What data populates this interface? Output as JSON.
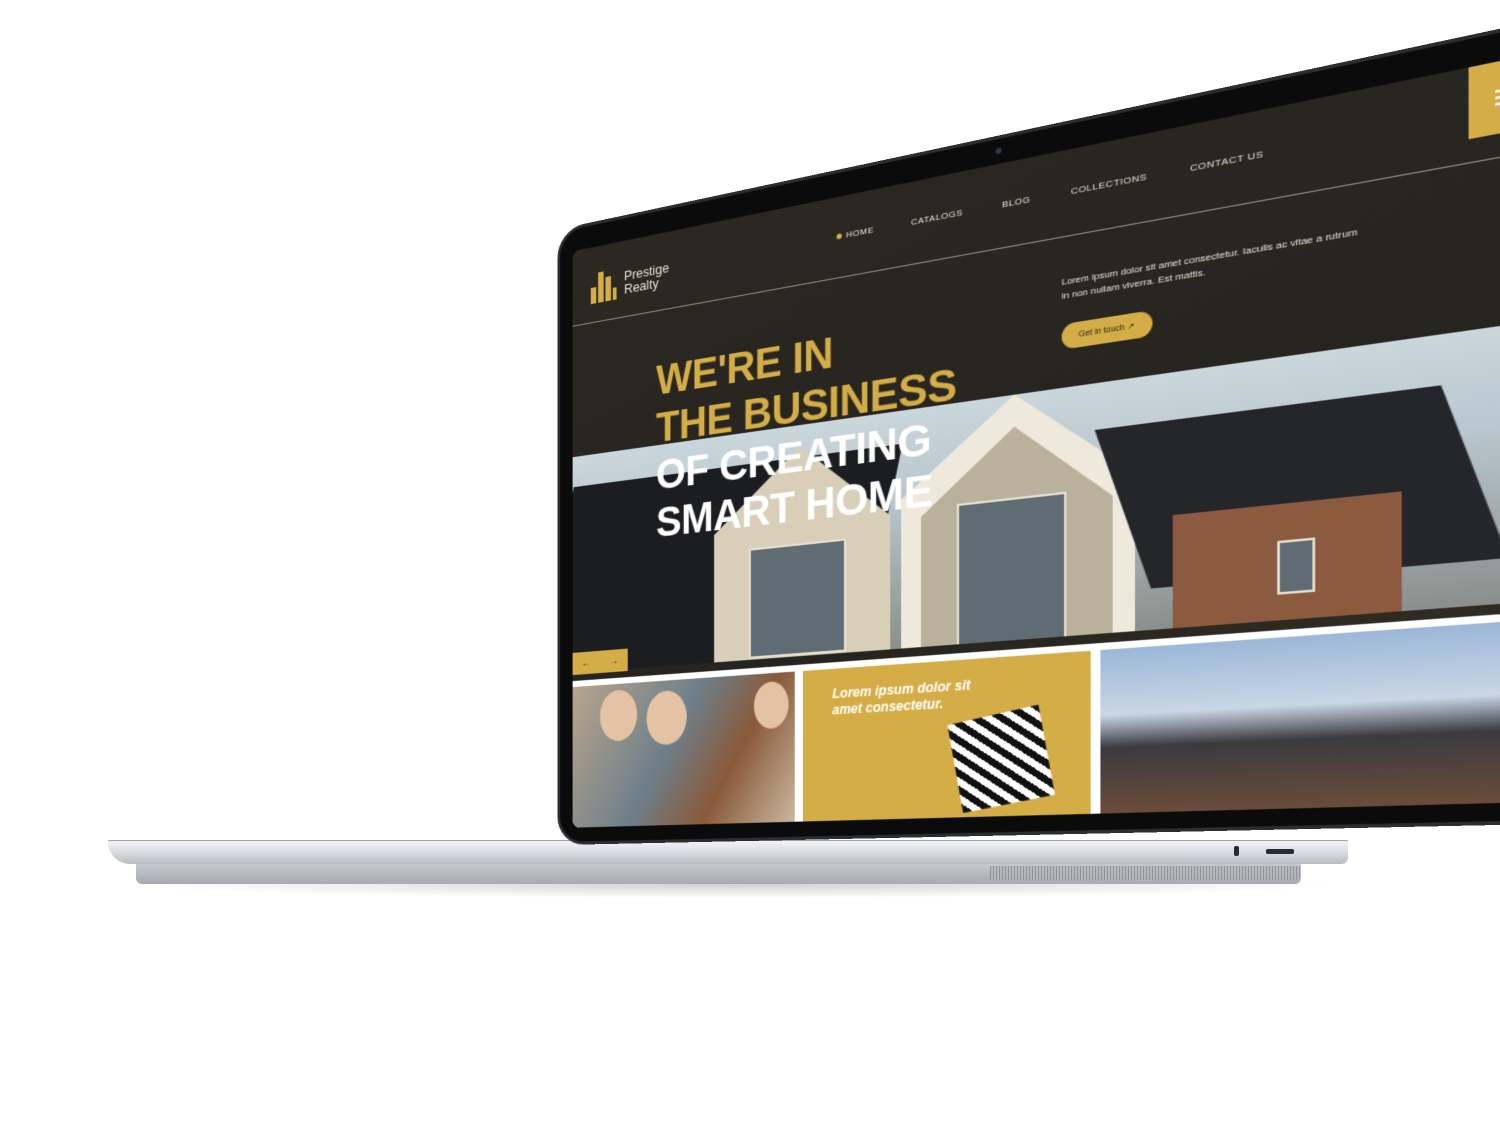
{
  "site": {
    "brand": {
      "line1": "Prestige",
      "line2": "Realty"
    },
    "nav": [
      {
        "label": "HOME",
        "active": true
      },
      {
        "label": "CATALOGS",
        "active": false
      },
      {
        "label": "BLOG",
        "active": false
      },
      {
        "label": "COLLECTIONS",
        "active": false
      },
      {
        "label": "CONTACT US",
        "active": false
      }
    ],
    "hero": {
      "line1": "WE'RE IN",
      "line2": "THE BUSINESS",
      "line3": "OF CREATING",
      "line4": "SMART HOME",
      "description": "Lorem ipsum dolor sit amet consectetur. Iaculis ac vitae a rutrum in non nullam viverra. Est mattis.",
      "cta_label": "Get in touch",
      "cta_icon": "arrow-up-right-icon"
    },
    "slider": {
      "prev_icon": "←",
      "next_icon": "→"
    },
    "tiles": {
      "gold_text": "Lorem ipsum dolor sit amet consectetur."
    },
    "colors": {
      "accent": "#d4ad47",
      "dark": "#2b2821"
    }
  }
}
